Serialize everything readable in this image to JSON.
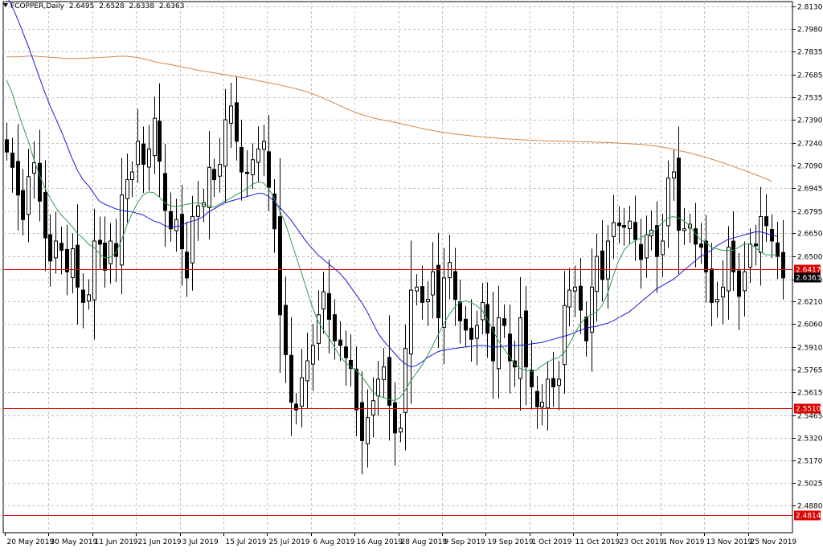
{
  "header": {
    "symbol": "FCOPPER",
    "timeframe": ",Daily",
    "open": "2.6495",
    "high": "2.6528",
    "low": "2.6338",
    "close": "2.6363"
  },
  "colors": {
    "background": "#ffffff",
    "grid": "#c0c0c0",
    "candle": "#000000",
    "ma_fast": "#2e9e4e",
    "ma_mid": "#1a1ad6",
    "ma_slow": "#d2874a",
    "hline": "#d80000",
    "current_tag": "#000000"
  },
  "chart_data": {
    "type": "candlestick",
    "ylim": [
      2.47,
      2.816
    ],
    "price_ticks": [
      "2.8130",
      "2.7980",
      "2.7835",
      "2.7685",
      "2.7535",
      "2.7390",
      "2.7240",
      "2.7090",
      "2.6945",
      "2.6795",
      "2.6650",
      "2.6500",
      "2.6350",
      "2.6210",
      "2.6060",
      "2.5910",
      "2.5765",
      "2.5615",
      "2.5465",
      "2.5320",
      "2.5170",
      "2.5025",
      "2.4880"
    ],
    "date_labels": [
      "20 May 2019",
      "30 May 2019",
      "11 Jun 2019",
      "21 Jun 2019",
      "3 Jul 2019",
      "15 Jul 2019",
      "25 Jul 2019",
      "6 Aug 2019",
      "16 Aug 2019",
      "28 Aug 2019",
      "9 Sep 2019",
      "19 Sep 2019",
      "1 Oct 2019",
      "11 Oct 2019",
      "23 Oct 2019",
      "1 Nov 2019",
      "13 Nov 2019",
      "25 Nov 2019"
    ],
    "date_label_index": [
      0,
      8,
      16,
      24,
      32,
      40,
      48,
      56,
      64,
      72,
      80,
      88,
      96,
      104,
      112,
      120,
      128,
      136
    ],
    "horizontal_levels": [
      {
        "value": 2.6417,
        "label": "2.6417"
      },
      {
        "value": 2.551,
        "label": "2.5510"
      },
      {
        "value": 2.4814,
        "label": "2.4814"
      }
    ],
    "current_price": {
      "value": 2.6363,
      "label": "2.6363"
    },
    "closes": [
      2.718,
      2.708,
      2.69,
      2.674,
      2.702,
      2.711,
      2.686,
      2.662,
      2.647,
      2.66,
      2.654,
      2.64,
      2.655,
      2.63,
      2.62,
      2.625,
      2.66,
      2.658,
      2.641,
      2.66,
      2.65,
      2.69,
      2.7,
      2.705,
      2.725,
      2.71,
      2.72,
      2.74,
      2.712,
      2.68,
      2.668,
      2.674,
      2.655,
      2.636,
      2.676,
      2.683,
      2.685,
      2.708,
      2.7,
      2.71,
      2.739,
      2.748,
      2.725,
      2.705,
      2.704,
      2.713,
      2.72,
      2.725,
      2.695,
      2.668,
      2.612,
      2.586,
      2.555,
      2.55,
      2.571,
      2.582,
      2.592,
      2.612,
      2.627,
      2.609,
      2.595,
      2.592,
      2.584,
      2.577,
      2.55,
      2.53,
      2.545,
      2.556,
      2.57,
      2.578,
      2.553,
      2.535,
      2.538,
      2.59,
      2.628,
      2.63,
      2.62,
      2.622,
      2.64,
      2.61,
      2.636,
      2.646,
      2.622,
      2.608,
      2.602,
      2.596,
      2.605,
      2.62,
      2.6,
      2.582,
      2.61,
      2.605,
      2.582,
      2.578,
      2.61,
      2.578,
      2.565,
      2.552,
      2.555,
      2.57,
      2.565,
      2.57,
      2.618,
      2.628,
      2.63,
      2.615,
      2.595,
      2.63,
      2.65,
      2.635,
      2.66,
      2.672,
      2.67,
      2.669,
      2.673,
      2.661,
      2.648,
      2.664,
      2.667,
      2.65,
      2.66,
      2.701,
      2.705,
      2.667,
      2.668,
      2.671,
      2.658,
      2.656,
      2.64,
      2.62,
      2.622,
      2.63,
      2.656,
      2.64,
      2.624,
      2.64,
      2.658,
      2.657,
      2.676,
      2.67,
      2.66,
      2.65,
      2.636
    ],
    "ma_fast": [
      2.765,
      2.757,
      2.7455,
      2.735,
      2.725,
      2.7135,
      2.7035,
      2.695,
      2.688,
      2.682,
      2.677,
      2.6735,
      2.6695,
      2.665,
      2.662,
      2.658,
      2.656,
      2.652,
      2.649,
      2.6495,
      2.6525,
      2.66,
      2.67,
      2.678,
      2.685,
      2.69,
      2.692,
      2.6915,
      2.6885,
      2.685,
      2.683,
      2.6825,
      2.683,
      2.684,
      2.6845,
      2.685,
      2.684,
      2.683,
      2.682,
      2.684,
      2.686,
      2.688,
      2.69,
      2.692,
      2.694,
      2.697,
      2.6985,
      2.698,
      2.694,
      2.688,
      2.68,
      2.672,
      2.661,
      2.65,
      2.639,
      2.628,
      2.617,
      2.608,
      2.602,
      2.597,
      2.591,
      2.585,
      2.581,
      2.578,
      2.576,
      2.572,
      2.567,
      2.562,
      2.559,
      2.558,
      2.557,
      2.556,
      2.558,
      2.563,
      2.569,
      2.574,
      2.579,
      2.585,
      2.592,
      2.599,
      2.606,
      2.612,
      2.617,
      2.62,
      2.621,
      2.62,
      2.618,
      2.615,
      2.609,
      2.602,
      2.595,
      2.59,
      2.585,
      2.58,
      2.577,
      2.576,
      2.575,
      2.576,
      2.579,
      2.581,
      2.583,
      2.584,
      2.587,
      2.593,
      2.6,
      2.606,
      2.61,
      2.612,
      2.614,
      2.618,
      2.626,
      2.637,
      2.647,
      2.654,
      2.658,
      2.66,
      2.662,
      2.664,
      2.665,
      2.668,
      2.672,
      2.675,
      2.676,
      2.675,
      2.673,
      2.67,
      2.665,
      2.661,
      2.659,
      2.656,
      2.655,
      2.654,
      2.654,
      2.654,
      2.656,
      2.658,
      2.658,
      2.656,
      2.653,
      2.651,
      2.651,
      2.651
    ],
    "ma_mid": [
      2.82,
      2.813,
      2.805,
      2.796,
      2.787,
      2.777,
      2.767,
      2.757,
      2.748,
      2.74,
      2.732,
      2.723,
      2.714,
      2.706,
      2.7,
      2.696,
      2.691,
      2.686,
      2.684,
      2.6825,
      2.681,
      2.68,
      2.6795,
      2.679,
      2.678,
      2.677,
      2.675,
      2.673,
      2.672,
      2.67,
      2.669,
      2.6695,
      2.67,
      2.672,
      2.673,
      2.674,
      2.676,
      2.679,
      2.681,
      2.683,
      2.685,
      2.686,
      2.687,
      2.688,
      2.689,
      2.69,
      2.691,
      2.691,
      2.689,
      2.686,
      2.682,
      2.678,
      2.674,
      2.669,
      2.664,
      2.659,
      2.655,
      2.651,
      2.648,
      2.645,
      2.642,
      2.639,
      2.635,
      2.63,
      2.625,
      2.62,
      2.614,
      2.607,
      2.6,
      2.595,
      2.591,
      2.587,
      2.583,
      2.58,
      2.578,
      2.579,
      2.581,
      2.584,
      2.586,
      2.588,
      2.589,
      2.5895,
      2.59,
      2.5905,
      2.591,
      2.5915,
      2.5918,
      2.592,
      2.5915,
      2.591,
      2.591,
      2.5915,
      2.592,
      2.592,
      2.592,
      2.5925,
      2.593,
      2.5935,
      2.594,
      2.595,
      2.596,
      2.597,
      2.598,
      2.599,
      2.6005,
      2.602,
      2.603,
      2.604,
      2.6045,
      2.6055,
      2.6065,
      2.608,
      2.61,
      2.612,
      2.614,
      2.617,
      2.62,
      2.623,
      2.626,
      2.629,
      2.631,
      2.633,
      2.635,
      2.638,
      2.641,
      2.644,
      2.647,
      2.65,
      2.652,
      2.654,
      2.657,
      2.659,
      2.661,
      2.662,
      2.663,
      2.664,
      2.665,
      2.666,
      2.666,
      2.665,
      2.664,
      2.663
    ],
    "ma_slow": [
      2.78,
      2.78,
      2.78,
      2.7802,
      2.7805,
      2.7805,
      2.7802,
      2.78,
      2.7798,
      2.7795,
      2.7792,
      2.779,
      2.779,
      2.779,
      2.7791,
      2.7792,
      2.7794,
      2.7795,
      2.7797,
      2.78,
      2.7803,
      2.7804,
      2.7804,
      2.78,
      2.7795,
      2.7788,
      2.778,
      2.777,
      2.7762,
      2.7755,
      2.775,
      2.7743,
      2.7735,
      2.7728,
      2.7721,
      2.7714,
      2.7708,
      2.7702,
      2.7696,
      2.769,
      2.7684,
      2.7678,
      2.7672,
      2.7666,
      2.766,
      2.7653,
      2.7645,
      2.7638,
      2.7631,
      2.7624,
      2.7617,
      2.7609,
      2.7601,
      2.7592,
      2.7582,
      2.7572,
      2.756,
      2.7546,
      2.7531,
      2.7515,
      2.7499,
      2.7482,
      2.7466,
      2.7451,
      2.7437,
      2.7424,
      2.7413,
      2.7403,
      2.7395,
      2.7388,
      2.7381,
      2.7374,
      2.7366,
      2.7358,
      2.735,
      2.7342,
      2.7334,
      2.7327,
      2.732,
      2.7314,
      2.7308,
      2.7303,
      2.7298,
      2.7294,
      2.729,
      2.7286,
      2.7282,
      2.7279,
      2.7276,
      2.7273,
      2.727,
      2.7267,
      2.7265,
      2.7263,
      2.7261,
      2.7259,
      2.7257,
      2.7255,
      2.7254,
      2.7253,
      2.7252,
      2.7251,
      2.725,
      2.7249,
      2.7248,
      2.7247,
      2.7246,
      2.7245,
      2.7244,
      2.7243,
      2.7242,
      2.724,
      2.7238,
      2.7236,
      2.7234,
      2.7232,
      2.723,
      2.7226,
      2.7222,
      2.7218,
      2.7212,
      2.7206,
      2.7198,
      2.719,
      2.7182,
      2.7174,
      2.7165,
      2.7155,
      2.7145,
      2.7134,
      2.7123,
      2.7111,
      2.7099,
      2.7086,
      2.7073,
      2.706,
      2.7047,
      2.7034,
      2.702,
      2.7006,
      2.699
    ]
  }
}
